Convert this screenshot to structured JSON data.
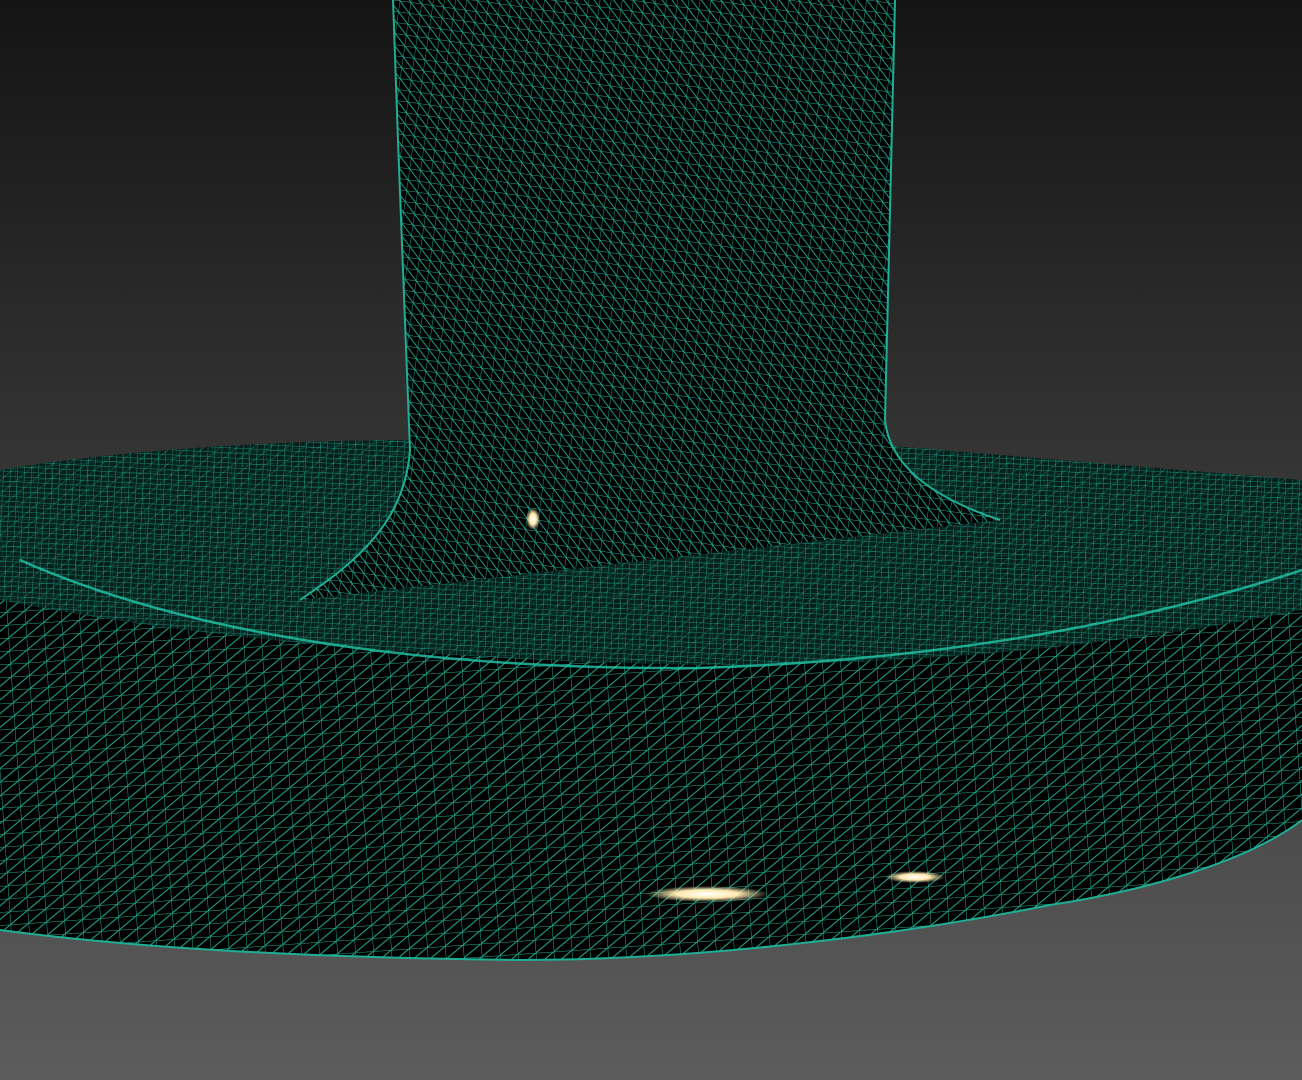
{
  "viewport": {
    "object": "wireframe-mesh",
    "shading": "wireframe",
    "colors": {
      "wire": "#1fae94",
      "mesh_fill": "#000000",
      "background_top": "#1a1a1a",
      "background_bottom": "#5a5a5a",
      "highlight": "#ffe9b0"
    },
    "parts": [
      "column",
      "base"
    ],
    "highlights": [
      {
        "name": "specular-spot-column"
      },
      {
        "name": "specular-spot-base-left"
      },
      {
        "name": "specular-spot-base-right"
      }
    ]
  }
}
